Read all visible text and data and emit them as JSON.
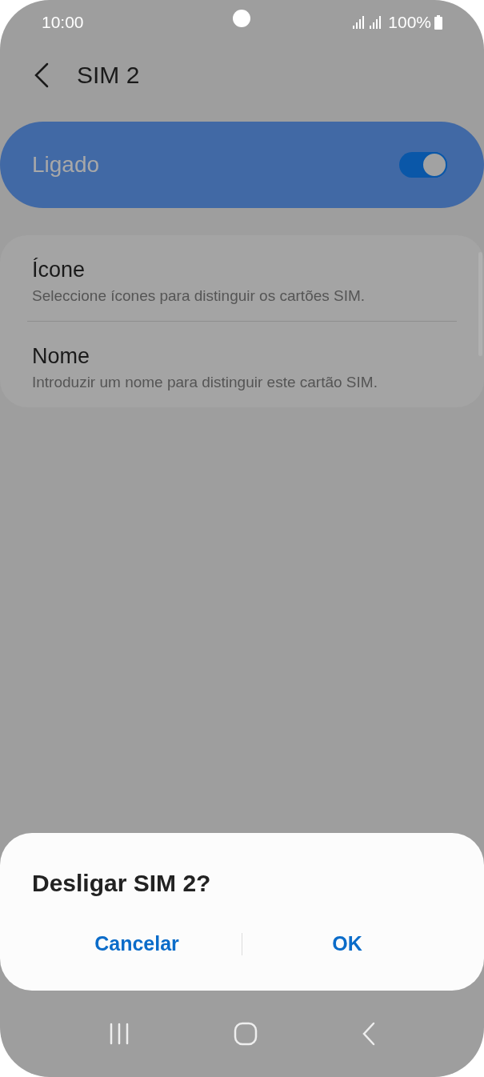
{
  "status_bar": {
    "time": "10:00",
    "battery": "100%"
  },
  "header": {
    "title": "SIM 2"
  },
  "master_switch": {
    "label": "Ligado",
    "on": true
  },
  "settings": [
    {
      "title": "Ícone",
      "subtitle": "Seleccione ícones para distinguir os cartões SIM."
    },
    {
      "title": "Nome",
      "subtitle": "Introduzir um nome para distinguir este cartão SIM."
    }
  ],
  "dialog": {
    "title": "Desligar SIM 2?",
    "buttons": [
      "Cancelar",
      "OK"
    ]
  }
}
